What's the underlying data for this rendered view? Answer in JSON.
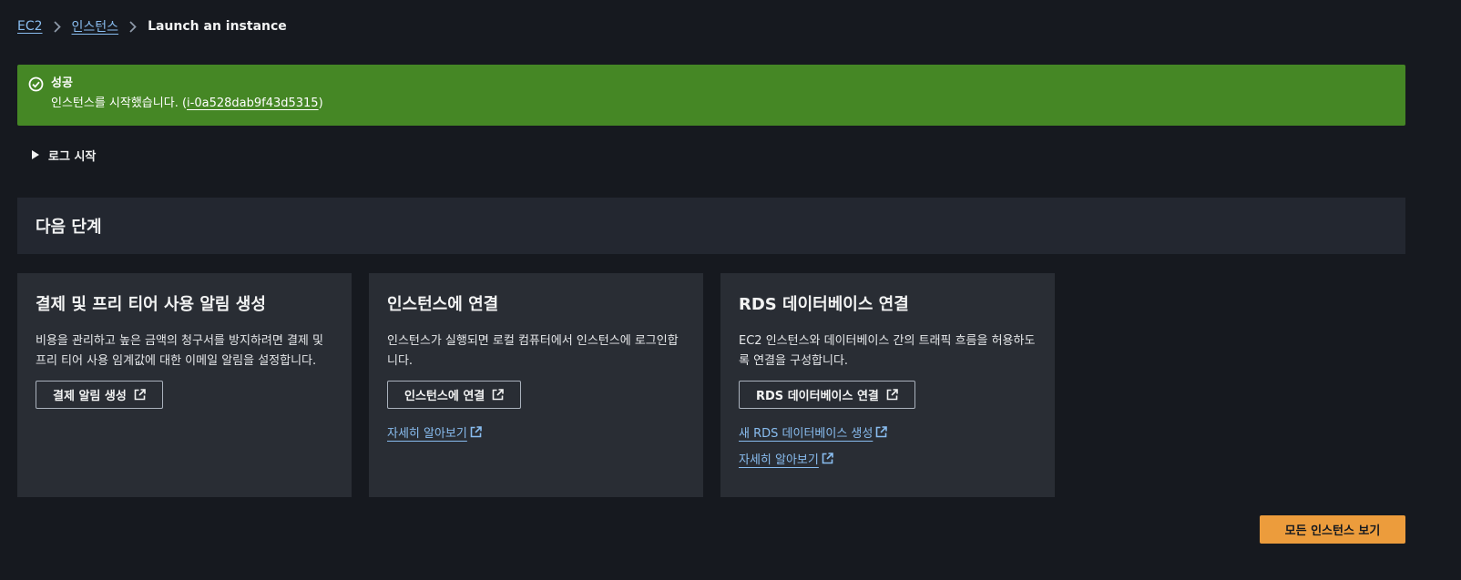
{
  "breadcrumb": {
    "items": [
      "EC2",
      "인스턴스"
    ],
    "current": "Launch an instance",
    "separator_icon": "chevron-right-icon"
  },
  "flash": {
    "icon": "check-circle-icon",
    "title": "성공",
    "message_prefix": "인스턴스를 시작했습니다. (",
    "instance_id": "i-0a528dab9f43d5315",
    "message_suffix": ")",
    "color": "#458725"
  },
  "log": {
    "label": "로그 시작",
    "icon": "caret-right-icon"
  },
  "next_steps": {
    "title": "다음 단계"
  },
  "cards": [
    {
      "title": "결제 및 프리 티어 사용 알림 생성",
      "description": "비용을 관리하고 높은 금액의 청구서를 방지하려면 결제 및 프리 티어 사용 임계값에 대한 이메일 알림을 설정합니다.",
      "button_label": "결제 알림 생성"
    },
    {
      "title": "인스턴스에 연결",
      "description": "인스턴스가 실행되면 로컬 컴퓨터에서 인스턴스에 로그인합니다.",
      "button_label": "인스턴스에 연결",
      "link_label": "자세히 알아보기"
    },
    {
      "title": "RDS 데이터베이스 연결",
      "description": "EC2 인스턴스와 데이터베이스 간의 트래픽 흐름을 허용하도록 연결을 구성합니다.",
      "button_label": "RDS 데이터베이스 연결",
      "link_label": "새 RDS 데이터베이스 생성",
      "link2_label": "자세히 알아보기"
    }
  ],
  "footer": {
    "primary_button": "모든 인스턴스 보기",
    "primary_color": "#ec9c3c"
  },
  "colors": {
    "background": "#16191f",
    "card": "#292d34",
    "link": "#89bdf0"
  }
}
